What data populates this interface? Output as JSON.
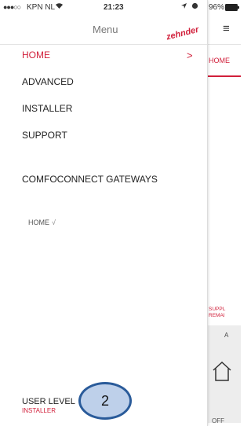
{
  "status_bar": {
    "signal": "●●●○○",
    "carrier": "KPN NL",
    "wifi_icon": "wifi-icon",
    "time": "21:23",
    "battery_percent": "96%"
  },
  "menu": {
    "title": "Menu",
    "logo_text": "zehnder",
    "items": [
      "HOME",
      "ADVANCED",
      "INSTALLER",
      "SUPPORT"
    ],
    "active_index": 0,
    "active_chevron": ">",
    "gateways_header": "COMFOCONNECT GATEWAYS",
    "gateways": [
      {
        "name": "HOME",
        "check": "√"
      }
    ],
    "user_level_label": "USER LEVEL",
    "user_level_value": "INSTALLER",
    "user_level_badge": "2"
  },
  "background_app": {
    "tab_label": "HOME",
    "supply_text_1": "SUPPL",
    "supply_text_2": "REMAI",
    "button_text": "A",
    "off_label": "OFF"
  },
  "colors": {
    "accent": "#d1203b",
    "badge_fill": "#bed0ea",
    "badge_border": "#2a5b9a"
  }
}
